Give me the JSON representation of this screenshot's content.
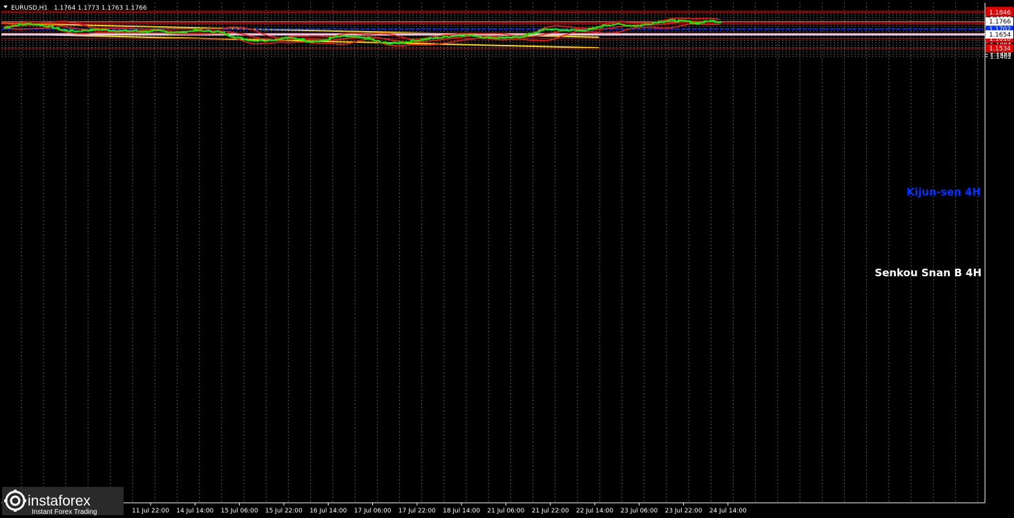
{
  "header": {
    "symbol": "EURUSD,H1",
    "ohlc": "1.1764 1.1773 1.1763 1.1766"
  },
  "colors": {
    "background": "#000000",
    "grid": "#5a5a5a",
    "candle": "#00ff00",
    "level": "#e00000",
    "channel": "#ffd700",
    "bollinger": "#ff1a1a",
    "kijun": "#0033ff",
    "senkou": "#dcd3ee"
  },
  "chart_data": {
    "type": "candlestick",
    "symbol": "EURUSD",
    "timeframe": "H1",
    "current_price": 1.1766,
    "y_ticks": [
      "1.1857",
      "1.1846",
      "1.1822",
      "1.1802",
      "1.1782",
      "1.1766",
      "1.1760",
      "1.1750",
      "1.1742",
      "1.1722",
      "1.1702",
      "1.1682",
      "1.1666",
      "1.1662",
      "1.1654",
      "1.1642",
      "1.1622",
      "1.1618",
      "1.1602",
      "1.1582",
      "1.1562",
      "1.1542",
      "1.1534",
      "1.1522",
      "1.1502",
      "1.1482",
      "1.1462"
    ],
    "x_ticks": [
      "11 Jul 22:00",
      "14 Jul 14:00",
      "15 Jul 06:00",
      "15 Jul 22:00",
      "16 Jul 14:00",
      "17 Jul 06:00",
      "17 Jul 22:00",
      "18 Jul 14:00",
      "21 Jul 06:00",
      "21 Jul 22:00",
      "22 Jul 14:00",
      "23 Jul 06:00",
      "23 Jul 22:00",
      "24 Jul 14:00"
    ],
    "levels": [
      {
        "value": 1.1857,
        "label": "1.1857"
      },
      {
        "value": 1.1846,
        "label": "1.1846"
      },
      {
        "value": 1.176,
        "label": "1.1760"
      },
      {
        "value": 1.175,
        "label": "1.1750"
      },
      {
        "value": 1.1666,
        "label": "1.1666"
      },
      {
        "value": 1.1618,
        "label": "1.1618"
      },
      {
        "value": 1.1534,
        "label": "1.1534"
      }
    ],
    "kijun_sen_4h": {
      "value": 1.1702,
      "label": "1.1702",
      "name": "Kijun-sen 4H"
    },
    "senkou_span_b_4h": {
      "value": 1.1654,
      "label": "1.1654",
      "name": "Senkou Snan B 4H"
    },
    "channel": [
      {
        "from_price": 1.1752,
        "to_price": 1.163
      },
      {
        "from_price": 1.166,
        "to_price": 1.1538
      }
    ],
    "price_path": [
      1.1714,
      1.1738,
      1.1748,
      1.1735,
      1.172,
      1.169,
      1.1683,
      1.1692,
      1.1698,
      1.169,
      1.1683,
      1.1686,
      1.168,
      1.1688,
      1.1675,
      1.1672,
      1.169,
      1.1685,
      1.1682,
      1.165,
      1.1622,
      1.1603,
      1.1604,
      1.161,
      1.1625,
      1.1617,
      1.1595,
      1.1598,
      1.163,
      1.164,
      1.1628,
      1.162,
      1.1585,
      1.1578,
      1.1588,
      1.1602,
      1.1615,
      1.1628,
      1.164,
      1.1652,
      1.1645,
      1.1628,
      1.1627,
      1.1625,
      1.1638,
      1.1664,
      1.17,
      1.1695,
      1.1692,
      1.169,
      1.17,
      1.1732,
      1.1745,
      1.1733,
      1.173,
      1.175,
      1.177,
      1.1775,
      1.1768,
      1.1752,
      1.1773,
      1.1766
    ]
  }
}
